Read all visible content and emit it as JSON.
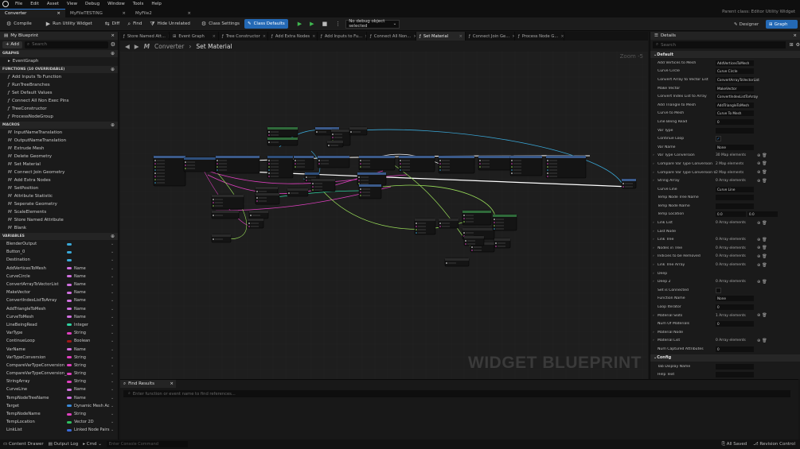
{
  "menubar": {
    "items": [
      "File",
      "Edit",
      "Asset",
      "View",
      "Debug",
      "Window",
      "Tools",
      "Help"
    ]
  },
  "doc_tabs": [
    {
      "label": "Converter",
      "active": true
    },
    {
      "label": "MyFileTESTING",
      "active": false
    },
    {
      "label": "MyFile2",
      "active": false
    }
  ],
  "parent_class": "Parent class: Editor Utility Widget",
  "toolbar": {
    "compile": "Compile",
    "run": "Run Utility Widget",
    "diff": "Diff",
    "find": "Find",
    "hide_unrelated": "Hide Unrelated",
    "class_settings": "Class Settings",
    "class_defaults": "Class Defaults",
    "debug_select": "No debug object selected",
    "designer": "Designer",
    "graph": "Graph"
  },
  "left_panel": {
    "title": "My Blueprint",
    "add": "+ Add",
    "search_placeholder": "Search",
    "graphs_header": "GRAPHS",
    "graphs": [
      "EventGraph"
    ],
    "functions_header": "FUNCTIONS (10 OVERRIDABLE)",
    "functions": [
      "Add Inputs To Function",
      "RunTreeBranches",
      "Set Default Values",
      "Connect All Non Exec Pins",
      "TreeConstructor",
      "ProcessNodeGroup"
    ],
    "macros_header": "MACROS",
    "macros": [
      "InputNameTranslation",
      "OutputNameTranslation",
      "Extrude Mesh",
      "Delete Geometry",
      "Set Material",
      "Connect Join Geometry",
      "Add Extra Nodes",
      "SetPosition",
      "Attribute Statistic",
      "Seperate Geometry",
      "ScaleElements",
      "Store Named Attribute",
      "Blank"
    ],
    "variables_header": "VARIABLES",
    "variables": [
      {
        "name": "BlenderOutput",
        "type": "",
        "color": "#3aa8d8"
      },
      {
        "name": "Button_0",
        "type": "",
        "color": "#3aa8d8"
      },
      {
        "name": "Destination",
        "type": "",
        "color": "#3aa8d8"
      },
      {
        "name": "AddVerticesToMesh",
        "type": "Name",
        "color": "#d070e0"
      },
      {
        "name": "CurveCircle",
        "type": "Name",
        "color": "#d070e0"
      },
      {
        "name": "ConvertArrayToVectorList",
        "type": "Name",
        "color": "#d070e0"
      },
      {
        "name": "MakeVector",
        "type": "Name",
        "color": "#d070e0"
      },
      {
        "name": "ConvertIndexListToArray",
        "type": "Name",
        "color": "#d070e0"
      },
      {
        "name": "AddTriangleToMesh",
        "type": "Name",
        "color": "#d070e0"
      },
      {
        "name": "CurveToMesh",
        "type": "Name",
        "color": "#d070e0"
      },
      {
        "name": "LineBeingRead",
        "type": "Integer",
        "color": "#2fd0a0"
      },
      {
        "name": "VarType",
        "type": "String",
        "color": "#e040c0"
      },
      {
        "name": "ContinueLoop",
        "type": "Boolean",
        "color": "#a01818"
      },
      {
        "name": "VarName",
        "type": "Name",
        "color": "#d070e0"
      },
      {
        "name": "VarTypeConversion",
        "type": "String",
        "color": "#e040c0"
      },
      {
        "name": "CompareVarTypeConversion",
        "type": "String",
        "color": "#e040c0"
      },
      {
        "name": "CompareVarTypeConversion_0",
        "type": "String",
        "color": "#e040c0"
      },
      {
        "name": "StringArray",
        "type": "String",
        "color": "#e040c0"
      },
      {
        "name": "CurveLine",
        "type": "Name",
        "color": "#d070e0"
      },
      {
        "name": "TempNodeTreeName",
        "type": "Name",
        "color": "#d070e0"
      },
      {
        "name": "Target",
        "type": "Dynamic Mesh Ac",
        "color": "#3a8ad8"
      },
      {
        "name": "TempNodeName",
        "type": "String",
        "color": "#e040c0"
      },
      {
        "name": "TempLocation",
        "type": "Vector 2D",
        "color": "#2fc060"
      },
      {
        "name": "LinkList",
        "type": "Linked Node Pairs",
        "color": "#3a6ad8"
      }
    ]
  },
  "graph_tabs": [
    "Store Named Att...",
    "Event Graph",
    "Tree Constructor",
    "Add Extra Nodes",
    "Add Inputs to Fu...",
    "Connect All Non...",
    "Set Material",
    "Connect Join Ge...",
    "Process Node G..."
  ],
  "breadcrumb": {
    "root": "Converter",
    "current": "Set Material",
    "zoom": "Zoom -5"
  },
  "watermark": "WIDGET BLUEPRINT",
  "find_results": {
    "tab": "Find Results",
    "placeholder": "Enter function or event name to find references..."
  },
  "details": {
    "title": "Details",
    "search_placeholder": "Search",
    "sections": [
      {
        "name": "Default",
        "rows": [
          {
            "label": "Add Vertices to Mesh",
            "value": "AddVerticesToMesh"
          },
          {
            "label": "Curve Circle",
            "value": "Curve Circle"
          },
          {
            "label": "Convert Array to Vector List",
            "value": "ConvertArrayToVectorList"
          },
          {
            "label": "Make Vector",
            "value": "MakeVector"
          },
          {
            "label": "Convert Index List to Array",
            "value": "ConvertIndexListToArray"
          },
          {
            "label": "Add Triangle to Mesh",
            "value": "AddTriangleToMesh"
          },
          {
            "label": "Curve to Mesh",
            "value": "Curve To Mesh"
          },
          {
            "label": "Line Being Read",
            "value": "0"
          },
          {
            "label": "Var Type",
            "value": ""
          },
          {
            "label": "Continue Loop",
            "value": "check"
          },
          {
            "label": "Var Name",
            "value": "None"
          },
          {
            "label": "Var Type Conversion",
            "value": "30 Map elements",
            "arr": true
          },
          {
            "label": "Compare Var Type Conversion",
            "value": "2 Map elements",
            "arr": true
          },
          {
            "label": "Compare Var Type Conversion 0",
            "value": "2 Map elements",
            "arr": true
          },
          {
            "label": "String Array",
            "value": "0 Array elements",
            "arr": true
          },
          {
            "label": "Curve Line",
            "value": "Curve Line"
          },
          {
            "label": "Temp Node Tree Name",
            "value": ""
          },
          {
            "label": "Temp Node Name",
            "value": ""
          },
          {
            "label": "Temp Location",
            "value": "0.0",
            "value2": "0.0"
          },
          {
            "label": "Link List",
            "value": "0 Array elements",
            "arr": true
          },
          {
            "label": "Last Node",
            "value": "none"
          },
          {
            "label": "Link Tree",
            "value": "0 Array elements",
            "arr": true
          },
          {
            "label": "Nodes in Tree",
            "value": "0 Array elements",
            "arr": true
          },
          {
            "label": "Indicies to be Removed",
            "value": "0 Array elements",
            "arr": true
          },
          {
            "label": "Link Tree Array",
            "value": "0 Array elements",
            "arr": true
          },
          {
            "label": "Deep",
            "value": "none"
          },
          {
            "label": "Deep 2",
            "value": "0 Array elements",
            "arr": true
          },
          {
            "label": "Set is Connected",
            "value": "box"
          },
          {
            "label": "Function Name",
            "value": "None"
          },
          {
            "label": "Loop Iterator",
            "value": "0"
          },
          {
            "label": "Material Slots",
            "value": "1 Array elements",
            "arr": true
          },
          {
            "label": "Num Of Materials",
            "value": "0"
          },
          {
            "label": "Material Node",
            "value": "none"
          },
          {
            "label": "Material List",
            "value": "0 Array elements",
            "arr": true
          },
          {
            "label": "Num Captured Attributes",
            "value": "0"
          }
        ]
      },
      {
        "name": "Config",
        "rows": [
          {
            "label": "Tab Display Name",
            "value": ""
          },
          {
            "label": "Help Text",
            "value": ""
          }
        ]
      }
    ]
  },
  "status": {
    "content_drawer": "Content Drawer",
    "output_log": "Output Log",
    "cmd": "Cmd",
    "console_placeholder": "Enter Console Command",
    "saved": "All Saved",
    "revision": "Revision Control"
  },
  "colors": {
    "accent": "#2469b5",
    "exec_wire": "#ffffff",
    "string_wire": "#e040c0",
    "float_wire": "#9adf5a",
    "object_wire": "#3aa8d8"
  }
}
